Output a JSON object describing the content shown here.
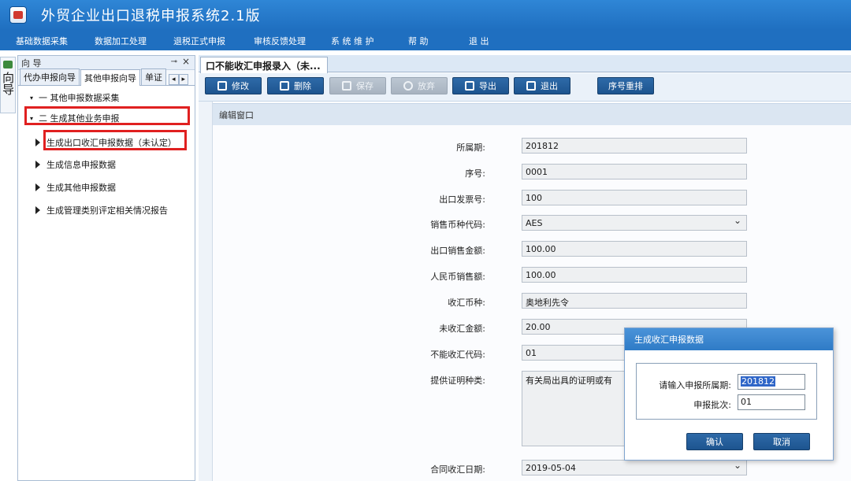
{
  "app": {
    "title": "外贸企业出口退税申报系统2.1版"
  },
  "menu": [
    "基础数据采集",
    "数据加工处理",
    "退税正式申报",
    "审核反馈处理",
    "系 统 维 护",
    "帮 助",
    "退 出"
  ],
  "left_vtab": {
    "label": "向导"
  },
  "guide": {
    "title": "向 导",
    "pin": "⊸",
    "close": "×",
    "tabs": [
      "代办申报向导",
      "其他申报向导",
      "单证"
    ],
    "active_tab": 1,
    "tab_nav_prev": "◂",
    "tab_nav_next": "▸",
    "tree": [
      {
        "toggle": "▾",
        "label": "一  其他申报数据采集"
      },
      {
        "toggle": "▾",
        "label": "二  生成其他业务申报"
      },
      {
        "label": "生成出口收汇申报数据（未认定）"
      },
      {
        "label": "生成信息申报数据"
      },
      {
        "label": "生成其他申报数据"
      },
      {
        "label": "生成管理类别评定相关情况报告"
      }
    ]
  },
  "doc_tab": {
    "label": "口不能收汇申报录入（未..."
  },
  "toolbar": {
    "buttons": [
      {
        "label": "修改",
        "icon": "edit-icon",
        "enabled": true
      },
      {
        "label": "删除",
        "icon": "trash-icon",
        "enabled": true
      },
      {
        "label": "保存",
        "icon": "save-icon",
        "enabled": false
      },
      {
        "label": "放弃",
        "icon": "cancel-icon",
        "enabled": false
      },
      {
        "label": "导出",
        "icon": "export-icon",
        "enabled": true
      },
      {
        "label": "退出",
        "icon": "exit-icon",
        "enabled": true
      },
      {
        "label": "序号重排",
        "icon": "",
        "enabled": true
      }
    ]
  },
  "section": {
    "title": "编辑窗口"
  },
  "form": {
    "fields": [
      {
        "label": "所属期:",
        "value": "201812"
      },
      {
        "label": "序号:",
        "value": "0001"
      },
      {
        "label": "出口发票号:",
        "value": "100"
      },
      {
        "label": "销售币种代码:",
        "value": "AES",
        "type": "select"
      },
      {
        "label": "出口销售金额:",
        "value": "100.00"
      },
      {
        "label": "人民币销售额:",
        "value": "100.00"
      },
      {
        "label": "收汇币种:",
        "value": "奥地利先令"
      },
      {
        "label": "未收汇金额:",
        "value": "20.00"
      },
      {
        "label": "不能收汇代码:",
        "value": "01"
      },
      {
        "label": "提供证明种类:",
        "value": "有关局出具的证明或有",
        "type": "multi"
      },
      {
        "label": "合同收汇日期:",
        "value": "2019-05-04",
        "type": "select"
      }
    ]
  },
  "dialog": {
    "title": "生成收汇申报数据",
    "period_label": "请输入申报所属期:",
    "period_value": "201812",
    "batch_label": "申报批次:",
    "batch_value": "01",
    "ok_label": "确认",
    "cancel_label": "取消"
  },
  "colors": {
    "title_bar": "#1f6fc0",
    "button": "#1d548f",
    "highlight": "#e02020"
  }
}
